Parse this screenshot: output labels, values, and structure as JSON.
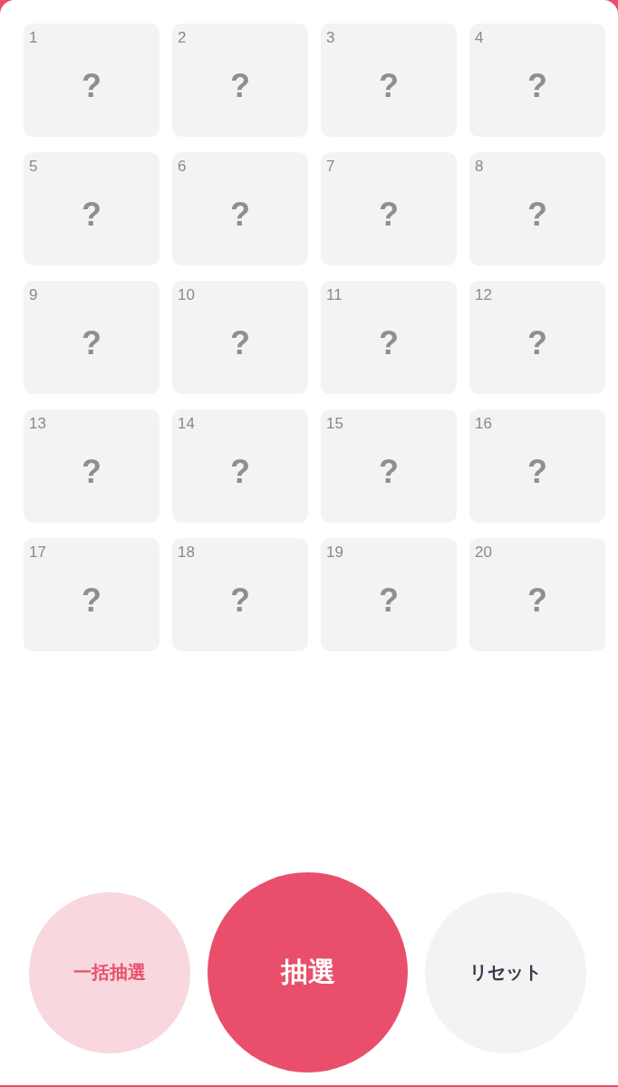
{
  "cells": [
    {
      "number": "1",
      "mark": "?"
    },
    {
      "number": "2",
      "mark": "?"
    },
    {
      "number": "3",
      "mark": "?"
    },
    {
      "number": "4",
      "mark": "?"
    },
    {
      "number": "5",
      "mark": "?"
    },
    {
      "number": "6",
      "mark": "?"
    },
    {
      "number": "7",
      "mark": "?"
    },
    {
      "number": "8",
      "mark": "?"
    },
    {
      "number": "9",
      "mark": "?"
    },
    {
      "number": "10",
      "mark": "?"
    },
    {
      "number": "11",
      "mark": "?"
    },
    {
      "number": "12",
      "mark": "?"
    },
    {
      "number": "13",
      "mark": "?"
    },
    {
      "number": "14",
      "mark": "?"
    },
    {
      "number": "15",
      "mark": "?"
    },
    {
      "number": "16",
      "mark": "?"
    },
    {
      "number": "17",
      "mark": "?"
    },
    {
      "number": "18",
      "mark": "?"
    },
    {
      "number": "19",
      "mark": "?"
    },
    {
      "number": "20",
      "mark": "?"
    }
  ],
  "buttons": [
    {
      "label": "一括抽選",
      "kind": "secondary"
    },
    {
      "label": "抽選",
      "kind": "primary"
    },
    {
      "label": "リセット",
      "kind": "neutral"
    }
  ]
}
